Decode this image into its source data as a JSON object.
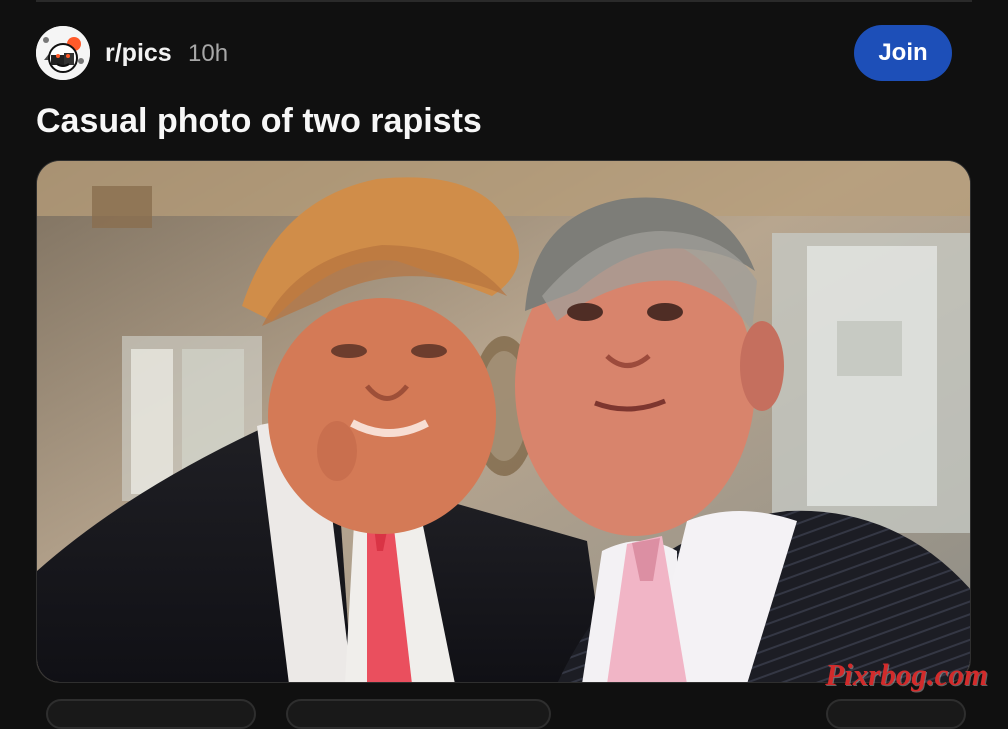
{
  "post": {
    "subreddit": "r/pics",
    "time": "10h",
    "join_label": "Join",
    "title": "Casual photo of two rapists"
  },
  "image": {
    "watermark": "Pixrbog.com"
  },
  "colors": {
    "background": "#101010",
    "join_button": "#1d4fb8",
    "watermark": "#d22b2b"
  },
  "icons": {
    "avatar": "reddit-snoo-avatar-icon"
  }
}
